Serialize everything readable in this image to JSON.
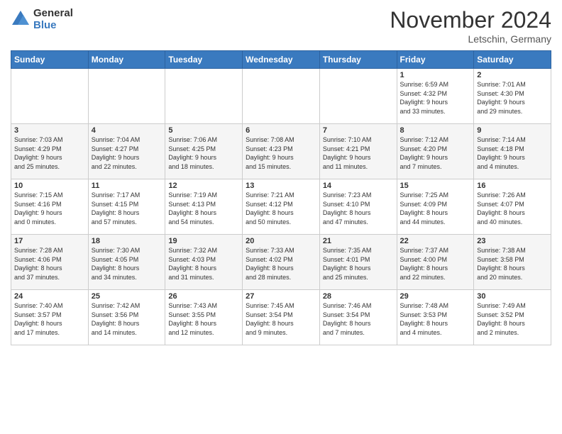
{
  "header": {
    "logo_line1": "General",
    "logo_line2": "Blue",
    "month": "November 2024",
    "location": "Letschin, Germany"
  },
  "days_of_week": [
    "Sunday",
    "Monday",
    "Tuesday",
    "Wednesday",
    "Thursday",
    "Friday",
    "Saturday"
  ],
  "weeks": [
    [
      {
        "day": "",
        "info": ""
      },
      {
        "day": "",
        "info": ""
      },
      {
        "day": "",
        "info": ""
      },
      {
        "day": "",
        "info": ""
      },
      {
        "day": "",
        "info": ""
      },
      {
        "day": "1",
        "info": "Sunrise: 6:59 AM\nSunset: 4:32 PM\nDaylight: 9 hours\nand 33 minutes."
      },
      {
        "day": "2",
        "info": "Sunrise: 7:01 AM\nSunset: 4:30 PM\nDaylight: 9 hours\nand 29 minutes."
      }
    ],
    [
      {
        "day": "3",
        "info": "Sunrise: 7:03 AM\nSunset: 4:29 PM\nDaylight: 9 hours\nand 25 minutes."
      },
      {
        "day": "4",
        "info": "Sunrise: 7:04 AM\nSunset: 4:27 PM\nDaylight: 9 hours\nand 22 minutes."
      },
      {
        "day": "5",
        "info": "Sunrise: 7:06 AM\nSunset: 4:25 PM\nDaylight: 9 hours\nand 18 minutes."
      },
      {
        "day": "6",
        "info": "Sunrise: 7:08 AM\nSunset: 4:23 PM\nDaylight: 9 hours\nand 15 minutes."
      },
      {
        "day": "7",
        "info": "Sunrise: 7:10 AM\nSunset: 4:21 PM\nDaylight: 9 hours\nand 11 minutes."
      },
      {
        "day": "8",
        "info": "Sunrise: 7:12 AM\nSunset: 4:20 PM\nDaylight: 9 hours\nand 7 minutes."
      },
      {
        "day": "9",
        "info": "Sunrise: 7:14 AM\nSunset: 4:18 PM\nDaylight: 9 hours\nand 4 minutes."
      }
    ],
    [
      {
        "day": "10",
        "info": "Sunrise: 7:15 AM\nSunset: 4:16 PM\nDaylight: 9 hours\nand 0 minutes."
      },
      {
        "day": "11",
        "info": "Sunrise: 7:17 AM\nSunset: 4:15 PM\nDaylight: 8 hours\nand 57 minutes."
      },
      {
        "day": "12",
        "info": "Sunrise: 7:19 AM\nSunset: 4:13 PM\nDaylight: 8 hours\nand 54 minutes."
      },
      {
        "day": "13",
        "info": "Sunrise: 7:21 AM\nSunset: 4:12 PM\nDaylight: 8 hours\nand 50 minutes."
      },
      {
        "day": "14",
        "info": "Sunrise: 7:23 AM\nSunset: 4:10 PM\nDaylight: 8 hours\nand 47 minutes."
      },
      {
        "day": "15",
        "info": "Sunrise: 7:25 AM\nSunset: 4:09 PM\nDaylight: 8 hours\nand 44 minutes."
      },
      {
        "day": "16",
        "info": "Sunrise: 7:26 AM\nSunset: 4:07 PM\nDaylight: 8 hours\nand 40 minutes."
      }
    ],
    [
      {
        "day": "17",
        "info": "Sunrise: 7:28 AM\nSunset: 4:06 PM\nDaylight: 8 hours\nand 37 minutes."
      },
      {
        "day": "18",
        "info": "Sunrise: 7:30 AM\nSunset: 4:05 PM\nDaylight: 8 hours\nand 34 minutes."
      },
      {
        "day": "19",
        "info": "Sunrise: 7:32 AM\nSunset: 4:03 PM\nDaylight: 8 hours\nand 31 minutes."
      },
      {
        "day": "20",
        "info": "Sunrise: 7:33 AM\nSunset: 4:02 PM\nDaylight: 8 hours\nand 28 minutes."
      },
      {
        "day": "21",
        "info": "Sunrise: 7:35 AM\nSunset: 4:01 PM\nDaylight: 8 hours\nand 25 minutes."
      },
      {
        "day": "22",
        "info": "Sunrise: 7:37 AM\nSunset: 4:00 PM\nDaylight: 8 hours\nand 22 minutes."
      },
      {
        "day": "23",
        "info": "Sunrise: 7:38 AM\nSunset: 3:58 PM\nDaylight: 8 hours\nand 20 minutes."
      }
    ],
    [
      {
        "day": "24",
        "info": "Sunrise: 7:40 AM\nSunset: 3:57 PM\nDaylight: 8 hours\nand 17 minutes."
      },
      {
        "day": "25",
        "info": "Sunrise: 7:42 AM\nSunset: 3:56 PM\nDaylight: 8 hours\nand 14 minutes."
      },
      {
        "day": "26",
        "info": "Sunrise: 7:43 AM\nSunset: 3:55 PM\nDaylight: 8 hours\nand 12 minutes."
      },
      {
        "day": "27",
        "info": "Sunrise: 7:45 AM\nSunset: 3:54 PM\nDaylight: 8 hours\nand 9 minutes."
      },
      {
        "day": "28",
        "info": "Sunrise: 7:46 AM\nSunset: 3:54 PM\nDaylight: 8 hours\nand 7 minutes."
      },
      {
        "day": "29",
        "info": "Sunrise: 7:48 AM\nSunset: 3:53 PM\nDaylight: 8 hours\nand 4 minutes."
      },
      {
        "day": "30",
        "info": "Sunrise: 7:49 AM\nSunset: 3:52 PM\nDaylight: 8 hours\nand 2 minutes."
      }
    ]
  ]
}
